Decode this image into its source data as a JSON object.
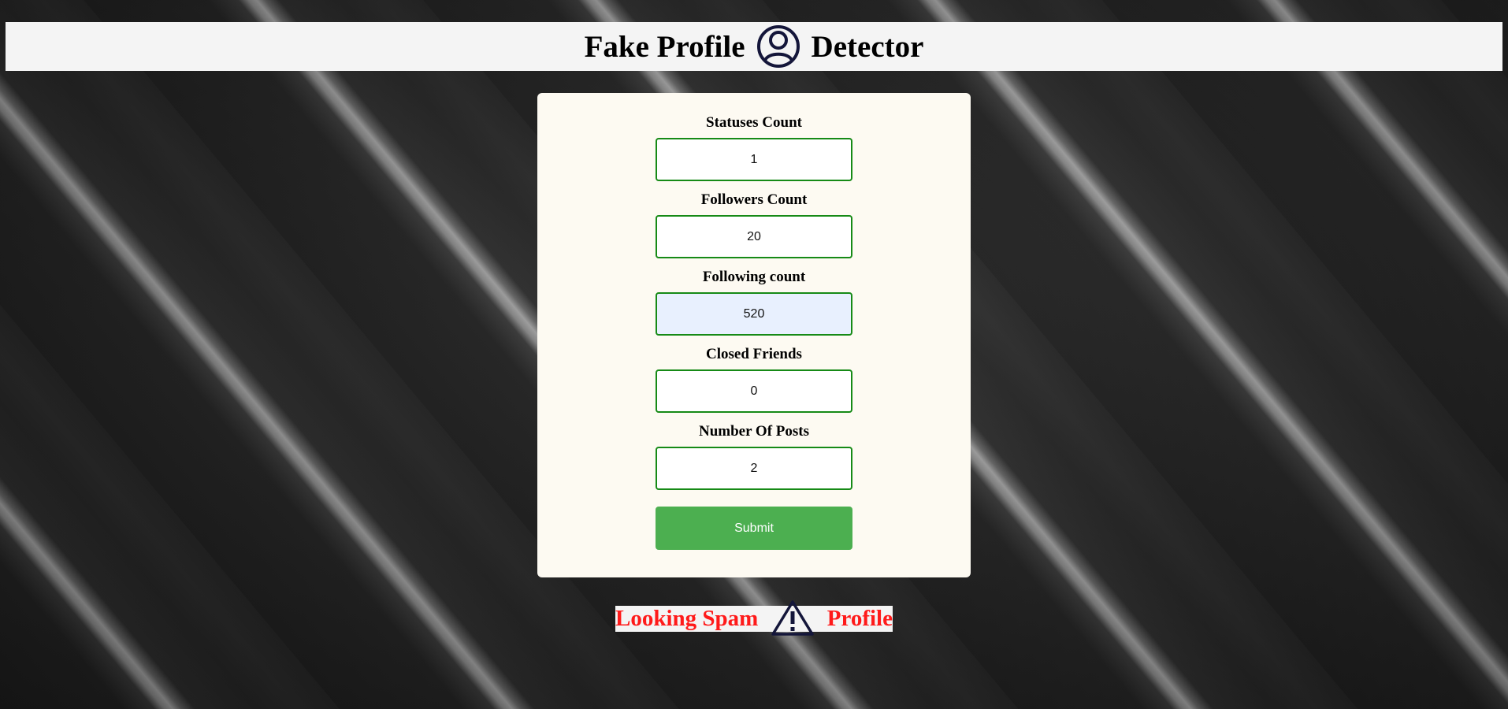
{
  "header": {
    "title_left": "Fake Profile",
    "title_right": "Detector",
    "logo_icon": "user-circle-icon"
  },
  "form": {
    "fields": [
      {
        "label": "Statuses Count",
        "value": "1"
      },
      {
        "label": "Followers Count",
        "value": "20"
      },
      {
        "label": "Following count",
        "value": "520"
      },
      {
        "label": "Closed Friends",
        "value": "0"
      },
      {
        "label": "Number Of Posts",
        "value": "2"
      }
    ],
    "submit_label": "Submit"
  },
  "result": {
    "text_left": "Looking Spam",
    "text_right": "Profile",
    "icon": "warning-triangle-icon",
    "color": "#ff1a1a"
  },
  "colors": {
    "accent_button": "#4caf50",
    "input_border": "#168a16",
    "card_bg": "#fdfaf2",
    "icon_dark": "#14163a"
  }
}
